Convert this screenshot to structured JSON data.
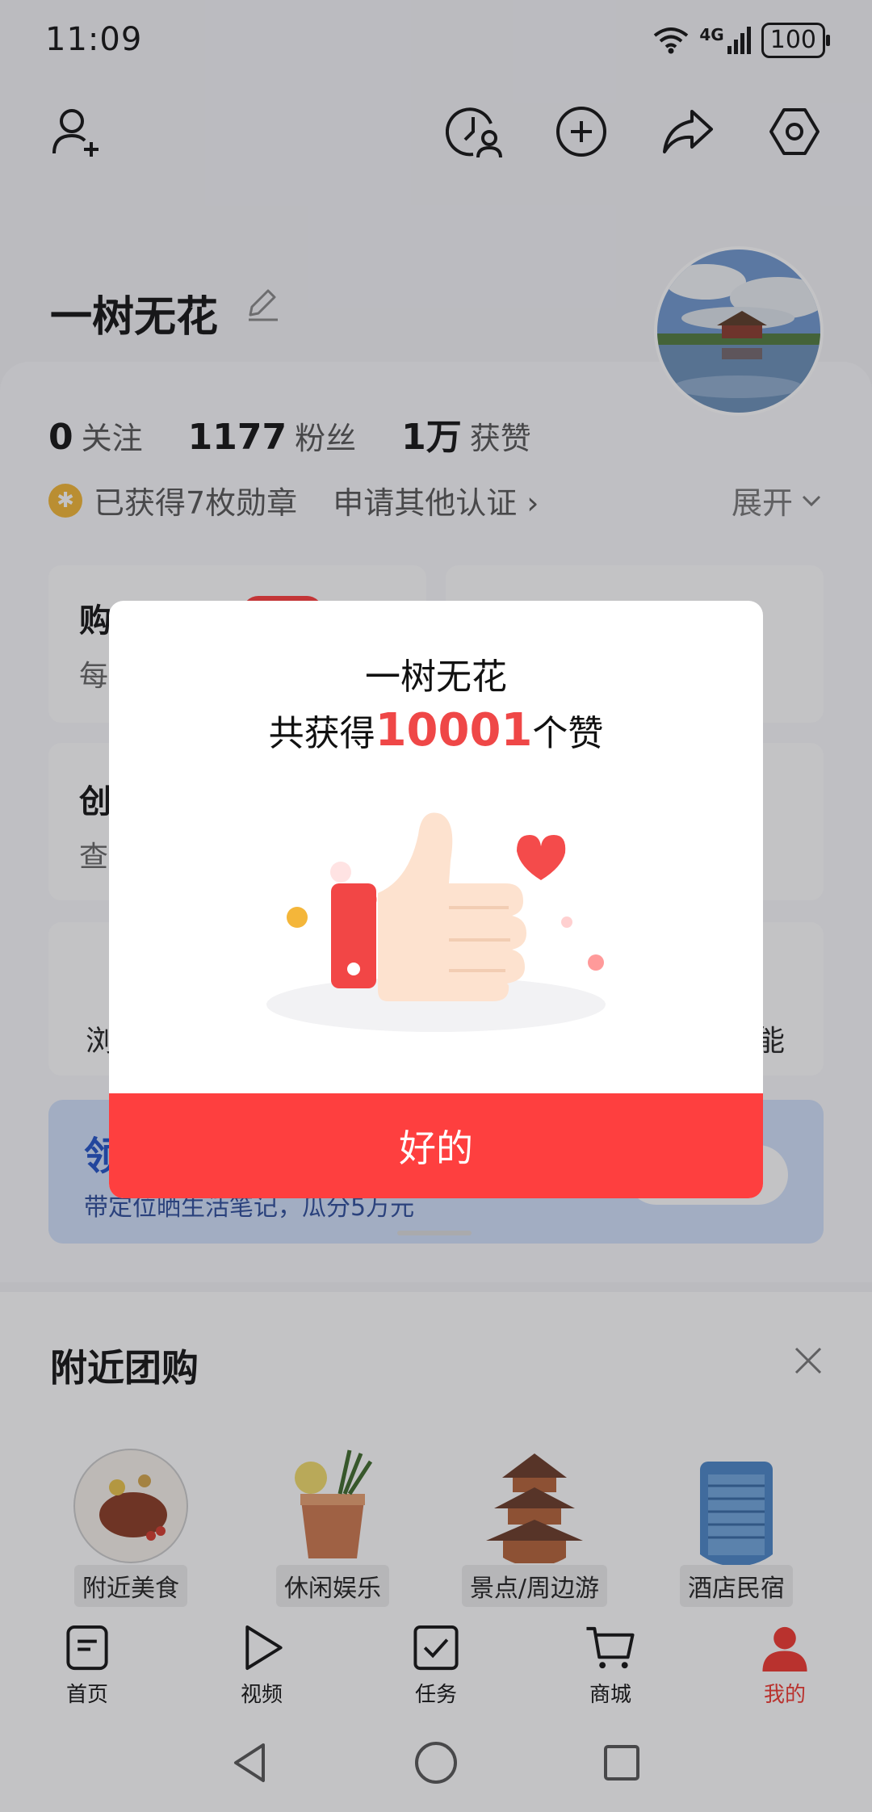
{
  "status": {
    "time": "11:09",
    "network": "4G",
    "battery": "100"
  },
  "profile": {
    "name": "一树无花"
  },
  "stats": [
    {
      "num": "0",
      "label": "关注"
    },
    {
      "num": "1177",
      "label": "粉丝"
    },
    {
      "num": "1万",
      "label": "获赞"
    }
  ],
  "medals": {
    "text": "已获得7枚勋章",
    "apply": "申请其他认证",
    "expand": "展开"
  },
  "background_cards": {
    "card1_title": "购",
    "card1_sub": "每",
    "card3_title": "创",
    "card3_sub": "查",
    "row3_left": "浏",
    "row3_right": "能"
  },
  "banner": {
    "title": "领",
    "subtitle": "带定位晒生活笔记，瓜分5万元"
  },
  "nearby": {
    "title": "附近团购",
    "items": [
      {
        "label": "附近美食",
        "icon": "food-icon"
      },
      {
        "label": "休闲娱乐",
        "icon": "drink-icon"
      },
      {
        "label": "景点/周边游",
        "icon": "pagoda-icon"
      },
      {
        "label": "酒店民宿",
        "icon": "hotel-icon"
      }
    ]
  },
  "tabs": [
    {
      "label": "首页",
      "icon": "home-icon"
    },
    {
      "label": "视频",
      "icon": "video-icon"
    },
    {
      "label": "任务",
      "icon": "task-icon"
    },
    {
      "label": "商城",
      "icon": "cart-icon"
    },
    {
      "label": "我的",
      "icon": "me-icon",
      "active": true
    }
  ],
  "modal": {
    "name": "一树无花",
    "prefix": "共获得",
    "count": "10001",
    "suffix": "个赞",
    "ok_label": "好的"
  },
  "colors": {
    "accent": "#fe3f3f",
    "like_count": "#ef4747",
    "badge": "#f3b634"
  }
}
